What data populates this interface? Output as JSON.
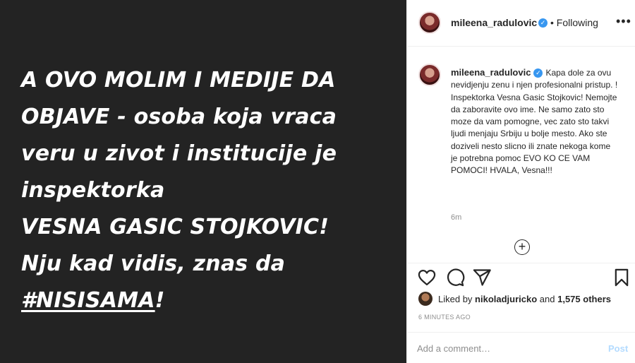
{
  "post": {
    "text_lines": [
      "A OVO MOLIM I MEDIJE DA",
      "OBJAVE - osoba koja vraca",
      "veru u zivot i institucije je",
      "inspektorka",
      "VESNA GASIC STOJKOVIC!",
      "Nju kad vidis, znas da"
    ],
    "hashtag": "#NISISAMA",
    "hashtag_suffix": "!"
  },
  "header": {
    "username": "mileena_radulovic",
    "verified_mark": "✓",
    "follow_state": "• Following",
    "more_icon": "•••"
  },
  "caption": {
    "username": "mileena_radulovic",
    "verified_mark": "✓",
    "text": "Kapa dole za ovu nevidjenju zenu i njen profesionalni pristup. ! Inspektorka Vesna Gasic Stojkovic! Nemojte da zaboravite ovo ime. Ne samo zato sto moze da vam pomogne, vec zato sto takvi ljudi menjaju Srbiju u bolje mesto. Ako ste doziveli nesto slicno ili znate nekoga kome je potrebna pomoc EVO KO CE VAM POMOCI! HVALA, Vesna!!!",
    "time": "6m",
    "load_more_icon": "+"
  },
  "actions": {
    "icons": [
      "heart-icon",
      "comment-icon",
      "share-icon",
      "bookmark-icon"
    ]
  },
  "likes": {
    "prefix": "Liked by ",
    "user": "nikoladjuricko",
    "middle": " and ",
    "count": "1,575 others"
  },
  "post_age": "6 MINUTES AGO",
  "comment_box": {
    "placeholder": "Add a comment…",
    "post_label": "Post"
  },
  "colors": {
    "image_background": "#232323",
    "verified": "#3897f0",
    "post_button_disabled": "#b3dbff"
  }
}
